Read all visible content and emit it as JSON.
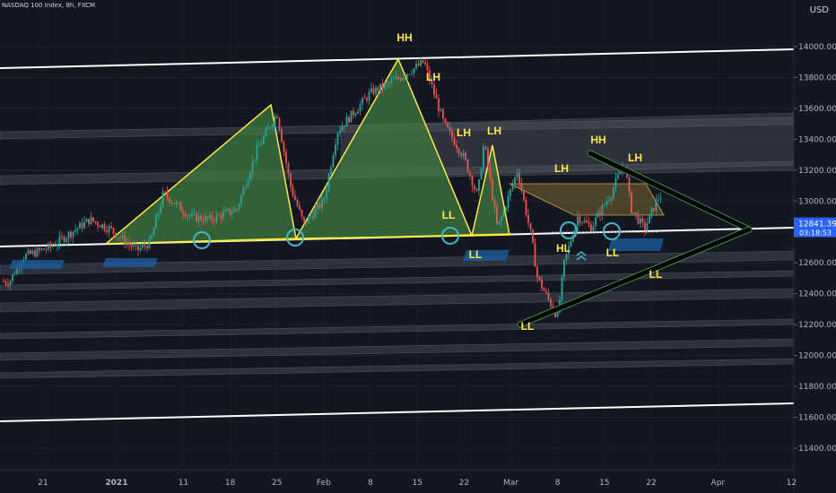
{
  "header": {
    "symbol_line": "NASDAQ 100 Index, 8h, FXCM",
    "currency": "USD"
  },
  "price_badge": {
    "price": "12841.39",
    "countdown": "03:18:53",
    "color": "#2962ff"
  },
  "colors": {
    "bg": "#131722",
    "up": "#26a69a",
    "down": "#ef5350",
    "channel": "#ffffff",
    "pattern": "#ffeb3b",
    "fill": "#3d7a3f",
    "circle": "#3fb6c4",
    "zone": "#1e5fa6",
    "wedge": "#000000"
  },
  "chart_data": {
    "type": "candlestick",
    "y_axis": {
      "ticks": [
        14000,
        13800,
        13600,
        13400,
        13200,
        13000,
        12800,
        12600,
        12400,
        12200,
        12000,
        11800,
        11600,
        11400
      ],
      "tick_labels": [
        "14000.00",
        "13800.00",
        "13600.00",
        "13400.00",
        "13200.00",
        "13000.00",
        "12800.00",
        "12600.00",
        "12400.00",
        "12200.00",
        "12000.00",
        "11800.00",
        "11600.00",
        "11400.00"
      ],
      "range": [
        11300,
        14150
      ]
    },
    "x_axis": {
      "tick_labels": [
        "21",
        "2021",
        "11",
        "18",
        "25",
        "Feb",
        "8",
        "15",
        "22",
        "Mar",
        "8",
        "15",
        "22",
        "Apr",
        "12"
      ]
    },
    "ohlc_keypoints": [
      {
        "date": "2020-12-16",
        "price": 12480
      },
      {
        "date": "2020-12-18",
        "price": 12640
      },
      {
        "date": "2020-12-22",
        "price": 12700
      },
      {
        "date": "2020-12-28",
        "price": 12880
      },
      {
        "date": "2020-12-31",
        "price": 12820
      },
      {
        "date": "2021-01-04",
        "price": 12680
      },
      {
        "date": "2021-01-06",
        "price": 12730
      },
      {
        "date": "2021-01-08",
        "price": 13050
      },
      {
        "date": "2021-01-12",
        "price": 12900
      },
      {
        "date": "2021-01-15",
        "price": 12880
      },
      {
        "date": "2021-01-19",
        "price": 12950
      },
      {
        "date": "2021-01-22",
        "price": 13330
      },
      {
        "date": "2021-01-25",
        "price": 13570
      },
      {
        "date": "2021-01-27",
        "price": 13100
      },
      {
        "date": "2021-01-29",
        "price": 12850
      },
      {
        "date": "2021-02-01",
        "price": 13000
      },
      {
        "date": "2021-02-03",
        "price": 13450
      },
      {
        "date": "2021-02-08",
        "price": 13700
      },
      {
        "date": "2021-02-12",
        "price": 13790
      },
      {
        "date": "2021-02-16",
        "price": 13900
      },
      {
        "date": "2021-02-19",
        "price": 13500
      },
      {
        "date": "2021-02-22",
        "price": 13280
      },
      {
        "date": "2021-02-24",
        "price": 13030
      },
      {
        "date": "2021-02-25",
        "price": 13380
      },
      {
        "date": "2021-02-27",
        "price": 12820
      },
      {
        "date": "2021-03-02",
        "price": 13200
      },
      {
        "date": "2021-03-04",
        "price": 12780
      },
      {
        "date": "2021-03-05",
        "price": 12500
      },
      {
        "date": "2021-03-08",
        "price": 12250
      },
      {
        "date": "2021-03-09",
        "price": 12600
      },
      {
        "date": "2021-03-11",
        "price": 12900
      },
      {
        "date": "2021-03-13",
        "price": 12830
      },
      {
        "date": "2021-03-16",
        "price": 13050
      },
      {
        "date": "2021-03-18",
        "price": 13250
      },
      {
        "date": "2021-03-19",
        "price": 12950
      },
      {
        "date": "2021-03-21",
        "price": 12820
      },
      {
        "date": "2021-03-23",
        "price": 13020
      },
      {
        "date": "2021-03-25",
        "price": 13100
      },
      {
        "date": "2021-03-27",
        "price": 12820
      },
      {
        "date": "2021-03-29",
        "price": 12841
      }
    ],
    "annotations": [
      "HH",
      "LH",
      "LH",
      "LH",
      "LL",
      "LL",
      "LH",
      "HH",
      "LH",
      "HL",
      "LL",
      "LL",
      "LL"
    ]
  }
}
